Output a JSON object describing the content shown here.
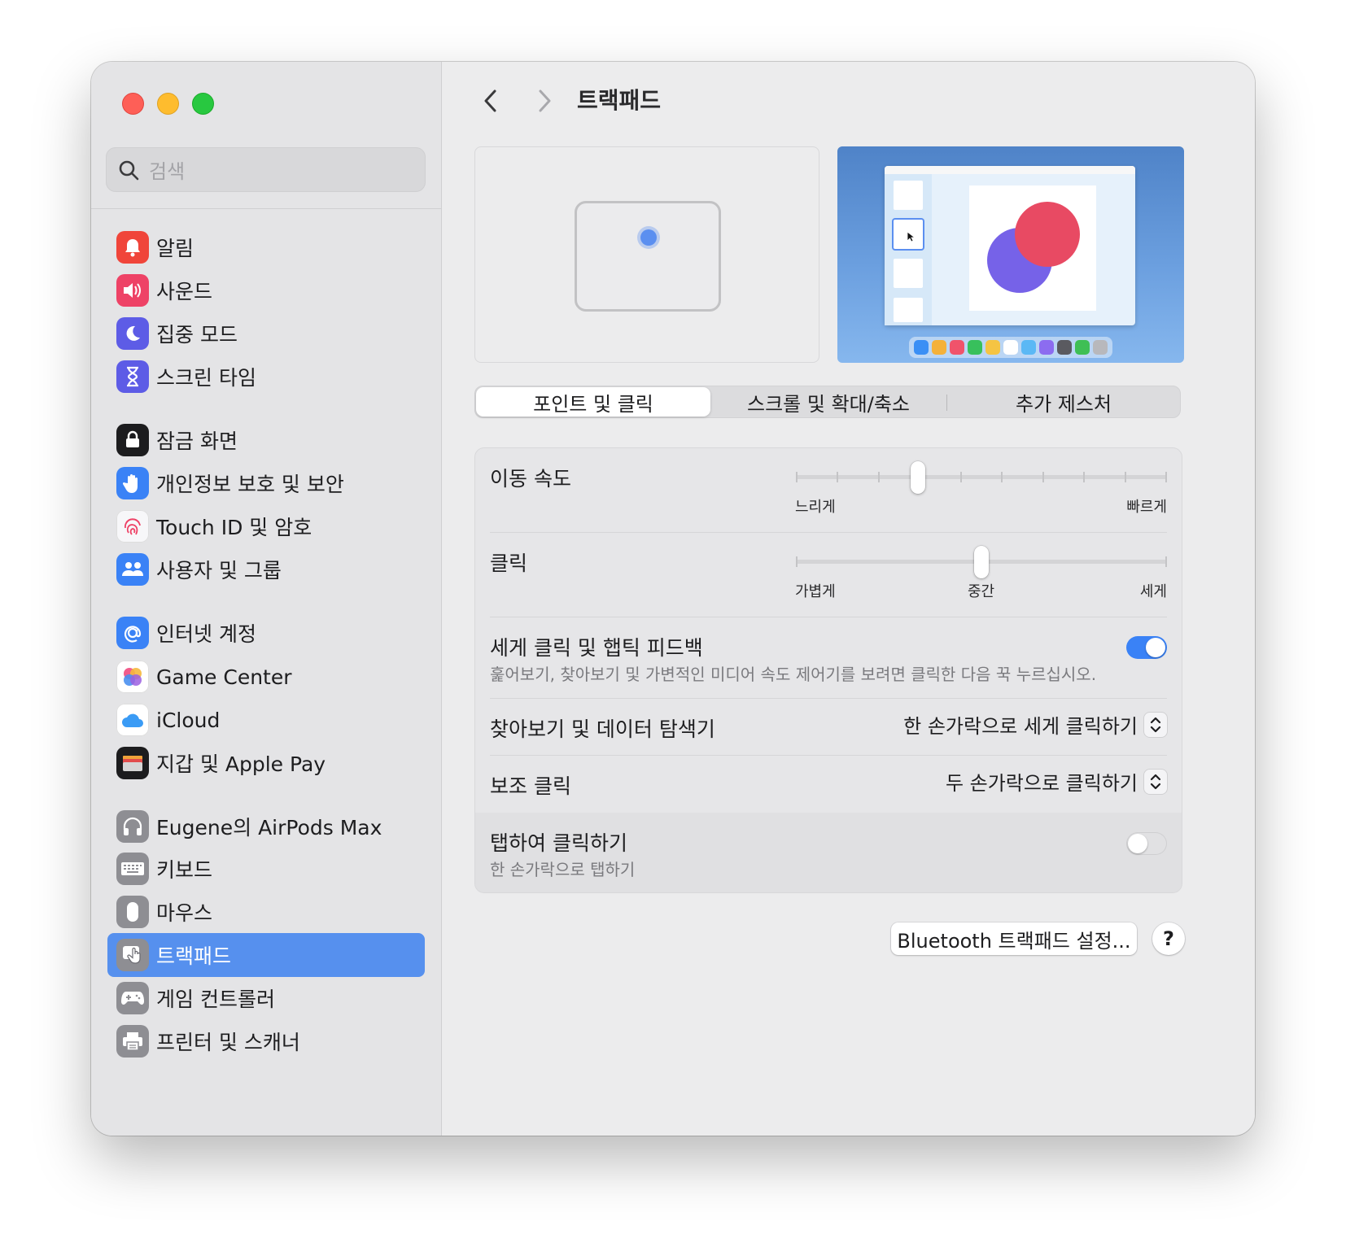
{
  "window": {
    "title": "트랙패드"
  },
  "search": {
    "placeholder": "검색"
  },
  "sidebar": {
    "items": [
      {
        "label": "알림",
        "icon": "bell-icon",
        "color": "#f0453a"
      },
      {
        "label": "사운드",
        "icon": "speaker-icon",
        "color": "#ee4266"
      },
      {
        "label": "집중 모드",
        "icon": "moon-icon",
        "color": "#5d5ce6"
      },
      {
        "label": "스크린 타임",
        "icon": "hourglass-icon",
        "color": "#5d5ce6"
      },
      {
        "label": "잠금 화면",
        "icon": "lock-icon",
        "color": "#1c1c1e"
      },
      {
        "label": "개인정보 보호 및 보안",
        "icon": "hand-icon",
        "color": "#3a82f6"
      },
      {
        "label": "Touch ID 및 암호",
        "icon": "fingerprint-icon",
        "color": "#f5f5f7"
      },
      {
        "label": "사용자 및 그룹",
        "icon": "users-icon",
        "color": "#3a82f6"
      },
      {
        "label": "인터넷 계정",
        "icon": "at-sign-icon",
        "color": "#3a82f6"
      },
      {
        "label": "Game Center",
        "icon": "game-center-icon",
        "color": "#ffffff"
      },
      {
        "label": "iCloud",
        "icon": "cloud-icon",
        "color": "#ffffff"
      },
      {
        "label": "지갑 및 Apple Pay",
        "icon": "wallet-icon",
        "color": "#1c1c1e"
      },
      {
        "label": "Eugene의 AirPods Max",
        "icon": "headphones-icon",
        "color": "#8e8e93"
      },
      {
        "label": "키보드",
        "icon": "keyboard-icon",
        "color": "#8e8e93"
      },
      {
        "label": "마우스",
        "icon": "mouse-icon",
        "color": "#8e8e93"
      },
      {
        "label": "트랙패드",
        "icon": "trackpad-icon",
        "color": "#8e8e93",
        "selected": true
      },
      {
        "label": "게임 컨트롤러",
        "icon": "gamepad-icon",
        "color": "#8e8e93"
      },
      {
        "label": "프린터 및 스캐너",
        "icon": "printer-icon",
        "color": "#8e8e93"
      }
    ]
  },
  "tabs": [
    "포인트 및 클릭",
    "스크롤 및 확대/축소",
    "추가 제스처"
  ],
  "active_tab": 0,
  "settings": {
    "tracking_speed": {
      "title": "이동 속도",
      "min_label": "느리게",
      "max_label": "빠르게",
      "value_fraction": 0.33,
      "tick_count": 10
    },
    "click": {
      "title": "클릭",
      "min_label": "가볍게",
      "mid_label": "중간",
      "max_label": "세게",
      "value_fraction": 0.5,
      "tick_count": 3
    },
    "force_click": {
      "title": "세게 클릭 및 햅틱 피드백",
      "subtitle": "훑어보기, 찾아보기 및 가변적인 미디어 속도 제어기를 보려면 클릭한 다음 꾹 누르십시오.",
      "on": true
    },
    "lookup": {
      "title": "찾아보기 및 데이터 탐색기",
      "value": "한 손가락으로 세게 클릭하기"
    },
    "secondary_click": {
      "title": "보조 클릭",
      "value": "두 손가락으로 클릭하기"
    },
    "tap_to_click": {
      "title": "탭하여 클릭하기",
      "subtitle": "한 손가락으로 탭하기",
      "on": false
    }
  },
  "buttons": {
    "bluetooth": "Bluetooth 트랙패드 설정...",
    "help": "?"
  },
  "colors": {
    "accent": "#3a82f6",
    "selection": "#5690ee"
  }
}
